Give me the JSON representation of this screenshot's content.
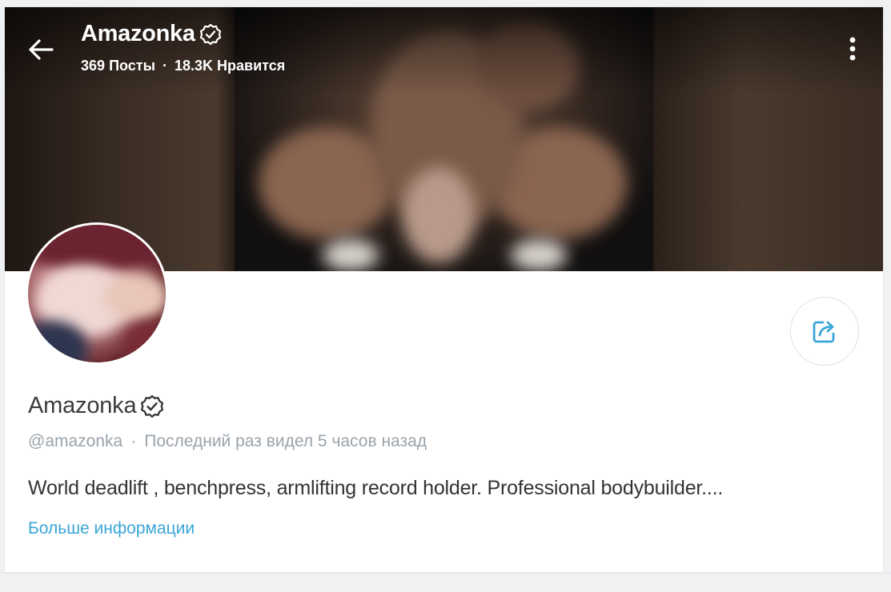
{
  "header": {
    "title": "Amazonka",
    "posts_count": "369",
    "posts_label": "Посты",
    "separator": "·",
    "likes_count": "18.3K",
    "likes_label": "Нравится"
  },
  "profile": {
    "name": "Amazonka",
    "username": "@amazonka",
    "separator": "·",
    "last_seen": "Последний раз видел 5 часов назад",
    "bio": "World deadlift , benchpress, armlifting record holder. Professional bodybuilder....",
    "more_info_label": "Больше информации"
  },
  "icons": {
    "back": "arrow-left-icon",
    "more": "more-vertical-icon",
    "verified": "verified-badge-icon",
    "share": "share-icon"
  },
  "colors": {
    "accent": "#3aa6d8",
    "muted_text": "#9aa3ab",
    "text": "#333333"
  }
}
